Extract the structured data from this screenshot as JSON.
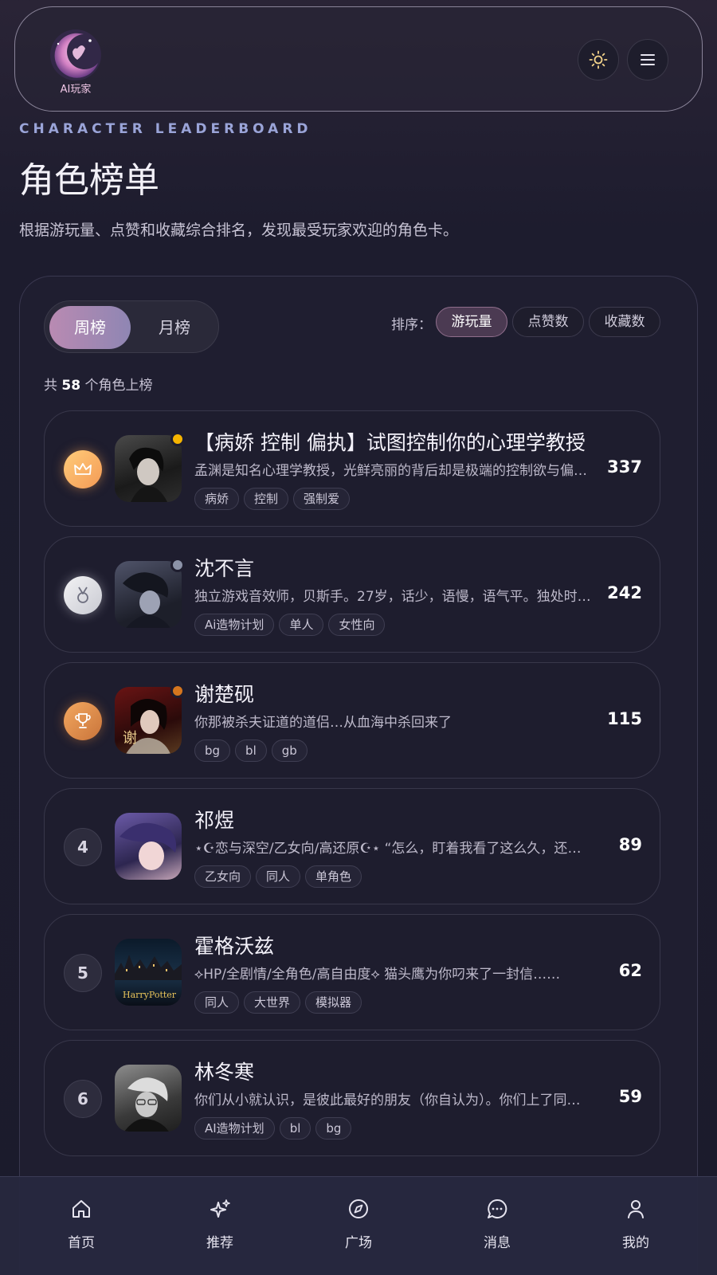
{
  "header": {
    "logo_text": "AI玩家",
    "theme_icon": "sun-icon",
    "menu_icon": "hamburger-menu-icon"
  },
  "hero": {
    "eyebrow": "CHARACTER LEADERBOARD",
    "title": "角色榜单",
    "subtitle": "根据游玩量、点赞和收藏综合排名，发现最受玩家欢迎的角色卡。"
  },
  "tabs": [
    {
      "label": "周榜",
      "active": true
    },
    {
      "label": "月榜",
      "active": false
    }
  ],
  "sort": {
    "label": "排序：",
    "options": [
      {
        "label": "游玩量",
        "active": true
      },
      {
        "label": "点赞数",
        "active": false
      },
      {
        "label": "收藏数",
        "active": false
      }
    ]
  },
  "count": {
    "prefix": "共",
    "value": "58",
    "suffix": "个角色上榜"
  },
  "rows": [
    {
      "rank": "1",
      "rank_icon": "crown-icon",
      "name": "【病娇 控制 偏执】试图控制你的心理学教授",
      "desc": "孟渊是知名心理学教授，光鲜亮丽的背后却是极端的控制欲与偏执……",
      "tags": [
        "病娇",
        "控制",
        "强制爱"
      ],
      "score": "337",
      "dot_color": "#f5b400"
    },
    {
      "rank": "2",
      "rank_icon": "medal-icon",
      "name": "沈不言",
      "desc": "独立游戏音效师，贝斯手。27岁，话少，语慢，语气平。独处时……",
      "tags": [
        "Ai造物计划",
        "单人",
        "女性向"
      ],
      "score": "242",
      "dot_color": "#8c93a8"
    },
    {
      "rank": "3",
      "rank_icon": "trophy-icon",
      "name": "谢楚砚",
      "desc": "你那被杀夫证道的道侣…从血海中杀回来了",
      "tags": [
        "bg",
        "bl",
        "gb"
      ],
      "score": "115",
      "dot_color": "#d5761e"
    },
    {
      "rank": "4",
      "rank_icon": "",
      "name": "祁煜",
      "desc": "⋆☪恋与深空/乙女向/高还原☪⋆ “怎么，盯着我看了这么久，还……",
      "tags": [
        "乙女向",
        "同人",
        "单角色"
      ],
      "score": "89",
      "dot_color": ""
    },
    {
      "rank": "5",
      "rank_icon": "",
      "name": "霍格沃兹",
      "desc": "⟡HP/全剧情/全角色/高自由度⟡ 猫头鹰为你叼来了一封信……",
      "tags": [
        "同人",
        "大世界",
        "模拟器"
      ],
      "score": "62",
      "dot_color": ""
    },
    {
      "rank": "6",
      "rank_icon": "",
      "name": "林冬寒",
      "desc": "你们从小就认识，是彼此最好的朋友（你自认为）。你们上了同一……",
      "tags": [
        "AI造物计划",
        "bl",
        "bg"
      ],
      "score": "59",
      "dot_color": ""
    }
  ],
  "bottom_nav": [
    {
      "label": "首页",
      "icon": "home-icon"
    },
    {
      "label": "推荐",
      "icon": "sparkles-icon"
    },
    {
      "label": "广场",
      "icon": "compass-icon"
    },
    {
      "label": "消息",
      "icon": "chat-bubble-icon"
    },
    {
      "label": "我的",
      "icon": "user-icon"
    }
  ]
}
